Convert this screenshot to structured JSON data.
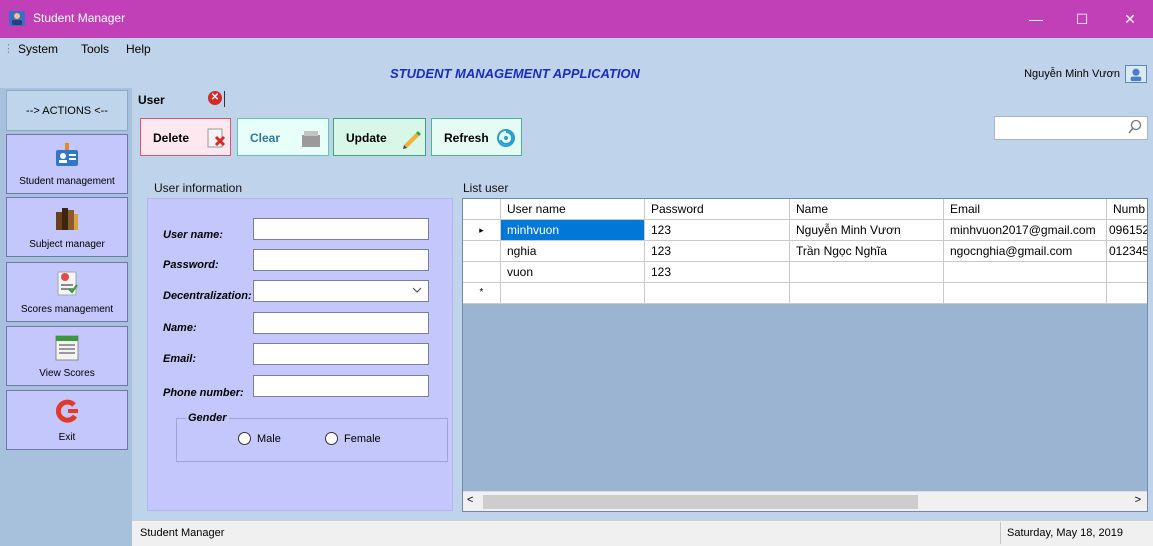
{
  "window": {
    "title": "Student Manager",
    "controls": [
      "—",
      "☐",
      "✕"
    ]
  },
  "menu": {
    "items": [
      "System",
      "Tools",
      "Help"
    ]
  },
  "header": {
    "app_title": "STUDENT MANAGEMENT APPLICATION",
    "user_name": "Nguyễn Minh Vươn"
  },
  "sidebar": {
    "header": "--> ACTIONS <--",
    "items": [
      {
        "label": "Student management",
        "icon": "student-card-icon"
      },
      {
        "label": "Subject manager",
        "icon": "books-icon"
      },
      {
        "label": "Scores management",
        "icon": "scores-icon"
      },
      {
        "label": "View Scores",
        "icon": "calendar-sheet-icon"
      },
      {
        "label": "Exit",
        "icon": "exit-icon"
      }
    ]
  },
  "tab": {
    "label": "User"
  },
  "toolbar": {
    "delete_label": "Delete",
    "clear_label": "Clear",
    "update_label": "Update",
    "refresh_label": "Refresh"
  },
  "search": {
    "value": ""
  },
  "form": {
    "caption": "User information",
    "username_label": "User name:",
    "password_label": "Password:",
    "decentralization_label": "Decentralization:",
    "name_label": "Name:",
    "email_label": "Email:",
    "phone_label": "Phone number:",
    "username_value": "",
    "password_value": "",
    "decentralization_value": "",
    "name_value": "",
    "email_value": "",
    "phone_value": "",
    "gender_caption": "Gender",
    "male_label": "Male",
    "female_label": "Female"
  },
  "grid": {
    "caption": "List user",
    "columns": [
      "User name",
      "Password",
      "Name",
      "Email",
      "Numb"
    ],
    "rows": [
      {
        "marker": "▸",
        "cells": [
          "minhvuon",
          "123",
          "Nguyễn Minh Vươn",
          "minhvuon2017@gmail.com",
          "096152"
        ]
      },
      {
        "marker": "",
        "cells": [
          "nghia",
          "123",
          "Trần Ngọc Nghĩa",
          "ngocnghia@gmail.com",
          "012345"
        ]
      },
      {
        "marker": "",
        "cells": [
          "vuon",
          "123",
          "",
          "",
          ""
        ]
      },
      {
        "marker": "*",
        "cells": [
          "",
          "",
          "",
          "",
          ""
        ]
      }
    ]
  },
  "scroll": {
    "left_arrow": "<",
    "right_arrow": ">"
  },
  "status": {
    "left": "Student Manager",
    "date": "Saturday, May 18, 2019"
  },
  "colors": {
    "titlebar": "#c13fb7",
    "panel": "#c3c7fb",
    "background": "#bfd3ea",
    "selection": "#0078d7"
  }
}
